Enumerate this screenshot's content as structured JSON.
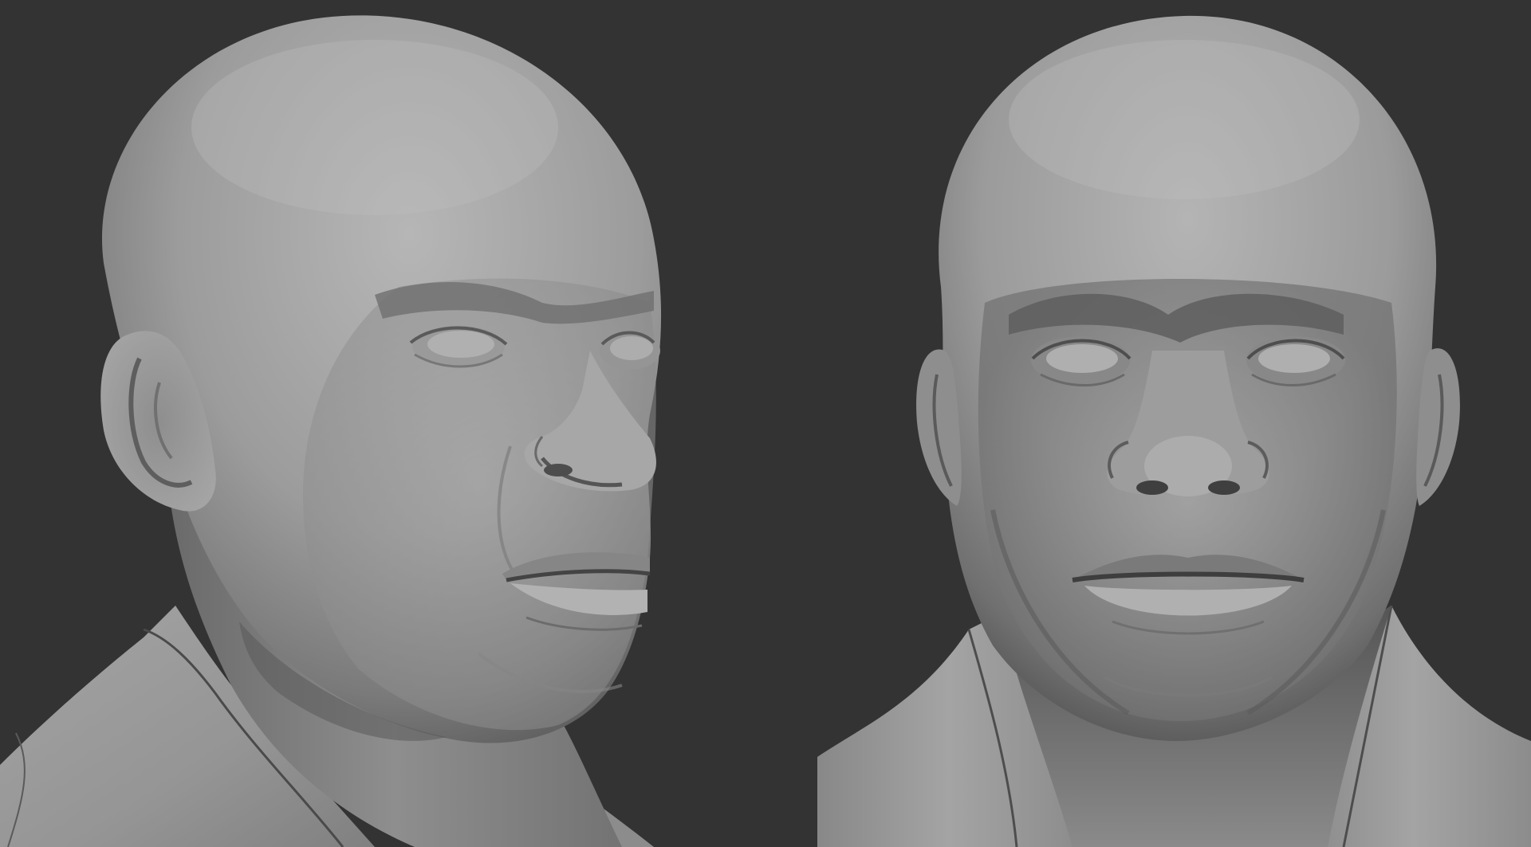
{
  "viewport": {
    "background_color": "#333333",
    "clay_color": "#a9a9a9",
    "shadow_color": "#3d3d3d"
  },
  "views": [
    {
      "kind": "three-quarter-left-view"
    },
    {
      "kind": "front-view"
    }
  ]
}
